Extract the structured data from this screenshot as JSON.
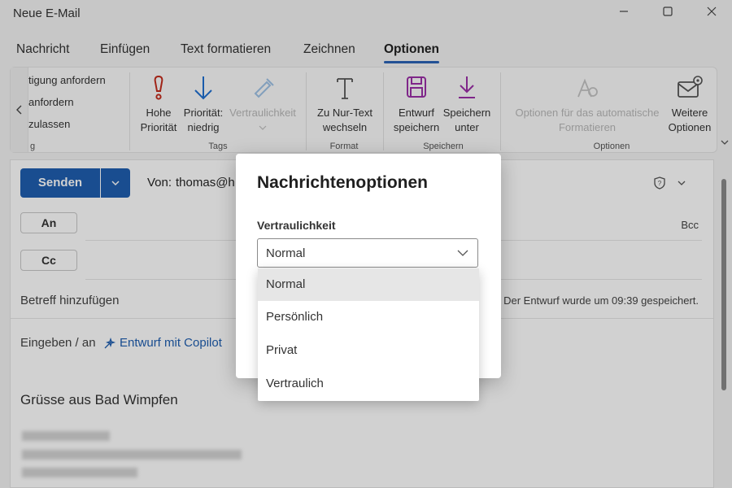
{
  "window": {
    "title": "Neue E-Mail",
    "minimize_icon": "minimize-icon",
    "maximize_icon": "maximize-icon",
    "close_icon": "close-icon"
  },
  "tabs": [
    {
      "label": "Nachricht"
    },
    {
      "label": "Einfügen"
    },
    {
      "label": "Text formatieren"
    },
    {
      "label": "Zeichnen"
    },
    {
      "label": "Optionen",
      "active": true
    }
  ],
  "ribbon": {
    "first_group_items": [
      "tigung anfordern",
      "anfordern",
      "zulassen"
    ],
    "first_group_label": "g",
    "tags": {
      "label": "Tags",
      "high_priority": [
        "Hohe",
        "Priorität"
      ],
      "low_priority": [
        "Priorität:",
        "niedrig"
      ],
      "sensitivity": "Vertraulichkeit"
    },
    "format": {
      "label": "Format",
      "plain_text": [
        "Zu Nur-Text",
        "wechseln"
      ]
    },
    "save": {
      "label": "Speichern",
      "save_draft": [
        "Entwurf",
        "speichern"
      ],
      "save_as": [
        "Speichern",
        "unter"
      ]
    },
    "options": {
      "label": "Optionen",
      "autoformat": [
        "Optionen für das automatische",
        "Formatieren"
      ],
      "more_options": [
        "Weitere",
        "Optionen"
      ]
    }
  },
  "compose": {
    "send_label": "Senden",
    "from_label": "Von:",
    "from_value": "thomas@h",
    "to_label": "An",
    "cc_label": "Cc",
    "bcc_label": "Bcc",
    "subject_placeholder": "Betreff hinzufügen",
    "draft_status": "Der Entwurf wurde um 09:39 gespeichert.",
    "body_prompt": "Eingeben / an",
    "copilot_link": "Entwurf mit Copilot",
    "greeting": "Grüsse aus Bad Wimpfen"
  },
  "dialog": {
    "title": "Nachrichtenoptionen",
    "sensitivity_label": "Vertraulichkeit",
    "selected_value": "Normal",
    "options": [
      "Normal",
      "Persönlich",
      "Privat",
      "Vertraulich"
    ]
  },
  "colors": {
    "accent": "#1f5eb0",
    "tab_underline": "#2b63b6",
    "priority_high": "#c42b1c",
    "priority_low": "#1f6fd1",
    "save_icon": "#9b2fa8"
  }
}
